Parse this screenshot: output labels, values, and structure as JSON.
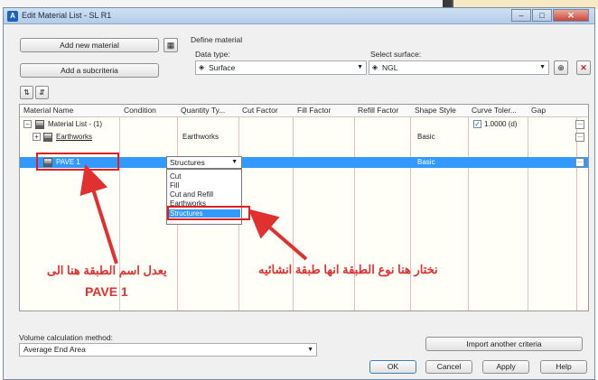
{
  "window": {
    "title": "Edit Material List - SL R1",
    "minimize": "–",
    "maximize": "□",
    "close": "✕"
  },
  "toolbar": {
    "add_material": "Add new material",
    "add_subcriteria": "Add a subcriteria",
    "define_material": "Define material",
    "data_type_label": "Data type:",
    "data_type_value": "Surface",
    "select_surface_label": "Select surface:",
    "select_surface_value": "NGL"
  },
  "grid": {
    "columns": [
      "Material Name",
      "Condition",
      "Quantity Ty...",
      "Cut Factor",
      "Fill Factor",
      "Refill Factor",
      "Shape Style",
      "Curve Toler...",
      "Gap"
    ],
    "rows": [
      {
        "name": "Material List - (1)",
        "quantity": "",
        "shape": "",
        "curve": "1.0000 (d)"
      },
      {
        "name": "Earthworks",
        "quantity": "Earthworks",
        "shape": "Basic",
        "curve": ""
      },
      {
        "name": "PAVE 1",
        "quantity": "Structures",
        "shape": "Basic",
        "curve": ""
      }
    ],
    "dropdown_selected": "Structures",
    "dropdown_options": [
      "Cut",
      "Fill",
      "Cut and Refill",
      "Earthworks",
      "Structures"
    ],
    "ellipsis": "..."
  },
  "annotations": {
    "right_note": "نختار هنا نوع الطبقة انها طبقة انشائيه",
    "left_note": "يعدل اسم الطبقة هنا الى",
    "pave_label": "PAVE 1"
  },
  "bottom": {
    "volume_label": "Volume calculation method:",
    "volume_value": "Average End Area",
    "import_button": "Import another criteria",
    "ok": "OK",
    "cancel": "Cancel",
    "apply": "Apply",
    "help": "Help"
  },
  "colors": {
    "selection": "#3399ff",
    "annotation_red": "#e03030",
    "grid_background": "#fffff8"
  }
}
